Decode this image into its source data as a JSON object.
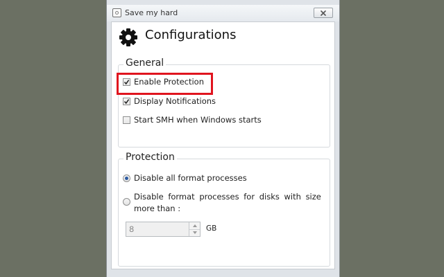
{
  "window": {
    "title": "Save my hard",
    "header_title": "Configurations"
  },
  "general": {
    "legend": "General",
    "options": [
      {
        "label": "Enable Protection",
        "checked": true
      },
      {
        "label": "Display Notifications",
        "checked": true
      },
      {
        "label": "Start SMH when Windows starts",
        "checked": false
      }
    ]
  },
  "protection": {
    "legend": "Protection",
    "options": [
      {
        "label": "Disable all format processes",
        "selected": true
      },
      {
        "label_line1": "Disable format processes for disks with size",
        "label_line2": "more than :",
        "selected": false
      }
    ],
    "size_value": "8",
    "size_unit": "GB"
  },
  "icons": {
    "app": "app-icon",
    "close": "close-icon",
    "header": "gear-icon"
  },
  "colors": {
    "highlight": "#e0141e",
    "radio_selected": "#2c5aa0",
    "background": "#6b7063"
  }
}
